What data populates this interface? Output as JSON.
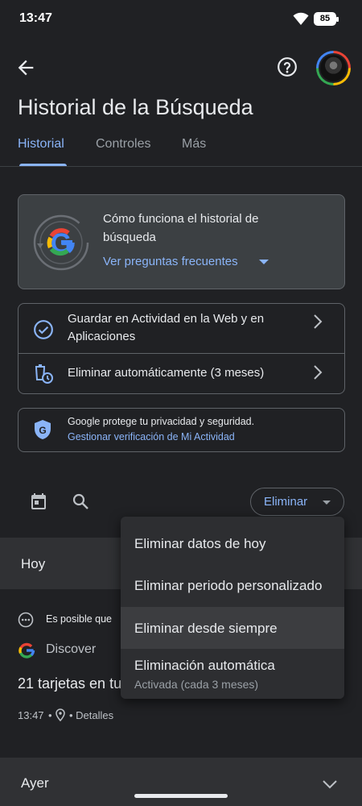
{
  "status": {
    "time": "13:47",
    "battery": "85"
  },
  "page": {
    "title": "Historial de la Búsqueda"
  },
  "tabs": [
    {
      "label": "Historial"
    },
    {
      "label": "Controles"
    },
    {
      "label": "Más"
    }
  ],
  "info_card": {
    "title": "Cómo funciona el historial de búsqueda",
    "link": "Ver preguntas frecuentes"
  },
  "settings": [
    {
      "label": "Guardar en Actividad en la Web y en Aplicaciones"
    },
    {
      "label": "Eliminar automáticamente (3 meses)"
    }
  ],
  "privacy": {
    "text": "Google protege tu privacidad y seguridad.",
    "link": "Gestionar verificación de Mi Actividad"
  },
  "toolbar": {
    "delete_label": "Eliminar"
  },
  "list": {
    "section_today": "Hoy",
    "notice": "Es posible que",
    "source": "Discover",
    "item_title": "21 tarjetas en tu",
    "time": "13:47",
    "details": "• Detalles",
    "section_yesterday": "Ayer"
  },
  "menu": {
    "items": [
      {
        "label": "Eliminar datos de hoy"
      },
      {
        "label": "Eliminar periodo personalizado"
      },
      {
        "label": "Eliminar desde siempre"
      },
      {
        "label": "Eliminación automática",
        "sub": "Activada (cada 3 meses)"
      }
    ]
  },
  "colors": {
    "accent": "#8ab4f8",
    "background": "#202124",
    "surface": "#3c4043"
  },
  "icons": [
    "back-arrow-icon",
    "help-icon",
    "google-logo-icon",
    "check-circle-icon",
    "auto-delete-icon",
    "shield-icon",
    "calendar-icon",
    "search-icon",
    "more-horiz-icon",
    "location-pin-icon",
    "chevron-right-icon",
    "chevron-down-icon"
  ]
}
